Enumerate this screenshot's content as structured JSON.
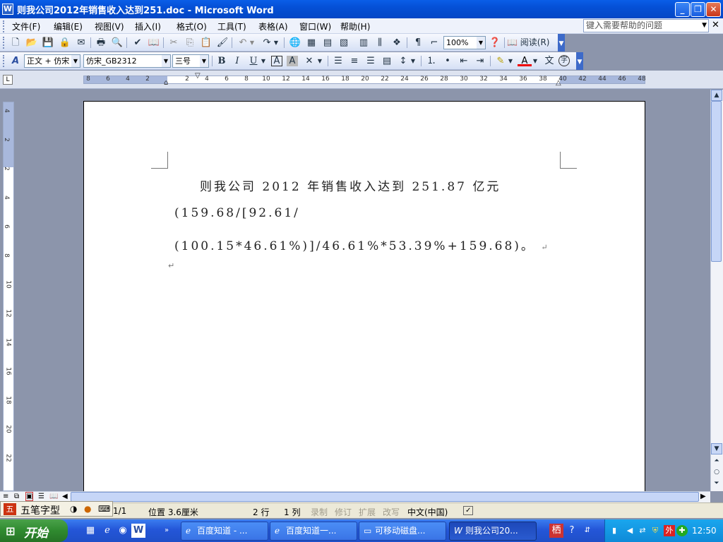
{
  "window": {
    "title": "则我公司2012年销售收入达到251.doc - Microsoft Word",
    "app_icon": "W"
  },
  "menu": {
    "items": [
      "文件(F)",
      "编辑(E)",
      "视图(V)",
      "插入(I)",
      "格式(O)",
      "工具(T)",
      "表格(A)",
      "窗口(W)",
      "帮助(H)"
    ],
    "help_placeholder": "键入需要帮助的问题"
  },
  "toolbar_standard": {
    "zoom": "100%",
    "read_label": "阅读(R)"
  },
  "toolbar_format": {
    "style": "正文 + 仿宋",
    "font": "仿宋_GB2312",
    "size": "三号"
  },
  "ruler": {
    "h_ticks": [
      "8",
      "6",
      "4",
      "2",
      "2",
      "4",
      "6",
      "8",
      "10",
      "12",
      "14",
      "16",
      "18",
      "20",
      "22",
      "24",
      "26",
      "28",
      "30",
      "32",
      "34",
      "36",
      "38",
      "40",
      "42",
      "44",
      "46",
      "48"
    ],
    "v_ticks": [
      "4",
      "2",
      "2",
      "4",
      "6",
      "8",
      "10",
      "12",
      "14",
      "16",
      "18",
      "20",
      "22"
    ]
  },
  "document": {
    "lines": [
      "则我公司 2012 年销售收入达到 251.87 亿元",
      "(159.68/[92.61/",
      "(100.15*46.61%)]/46.61%*53.39%+159.68)。"
    ],
    "para_mark": "↵"
  },
  "statusbar": {
    "page": "1/1",
    "position": "位置 3.6厘米",
    "line": "2 行",
    "col": "1 列",
    "rec": "录制",
    "trk": "修订",
    "ext": "扩展",
    "ovr": "改写",
    "lang": "中文(中国)"
  },
  "ime": {
    "name": "五笔字型"
  },
  "taskbar": {
    "start": "开始",
    "tasks": [
      "百度知道 - ...",
      "百度知道一...",
      "可移动磁盘...",
      "则我公司20..."
    ],
    "clock": "12:50"
  },
  "colors": {
    "titlebar": "#0550d6",
    "taskbar": "#2456d8",
    "start": "#2f8a2f",
    "tray": "#0e8ad8",
    "doc_bg": "#8c95ab"
  }
}
